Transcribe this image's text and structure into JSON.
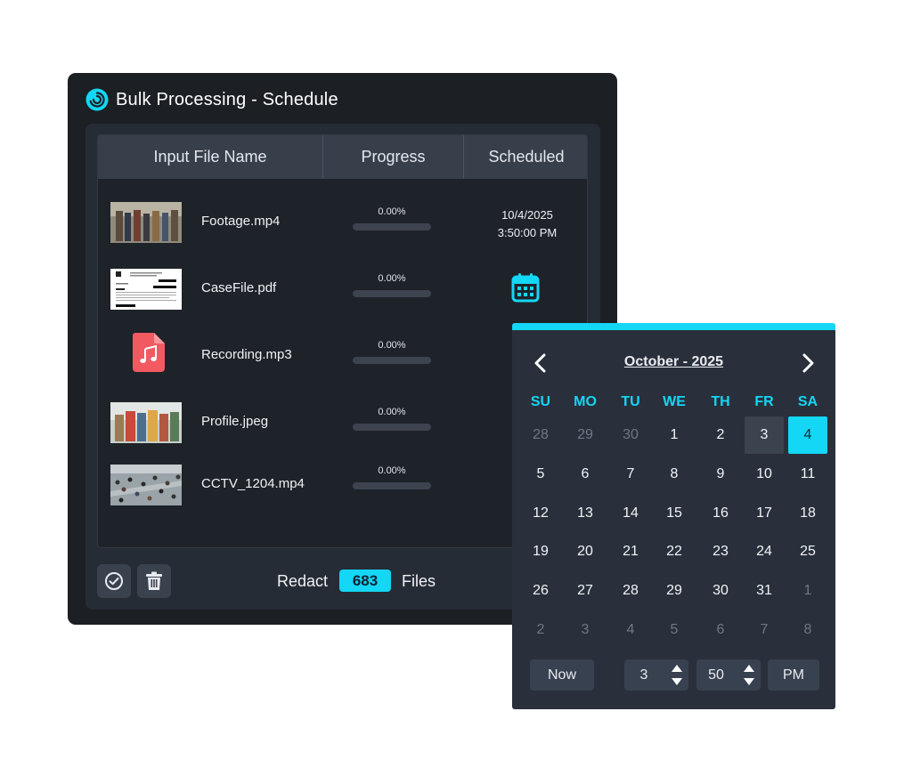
{
  "window": {
    "title": "Bulk Processing - Schedule",
    "logo_icon": "swirl-logo-icon",
    "accent": "#14d6f5"
  },
  "table": {
    "headers": [
      "Input File Name",
      "Progress",
      "Scheduled"
    ],
    "rows": [
      {
        "name": "Footage.mp4",
        "progress": 0,
        "progress_label": "0.00%",
        "scheduled_date": "10/4/2025",
        "scheduled_time": "3:50:00 PM",
        "thumb": "crowd-street"
      },
      {
        "name": "CaseFile.pdf",
        "progress": 0,
        "progress_label": "0.00%",
        "scheduled_icon": "calendar-icon",
        "thumb": "document"
      },
      {
        "name": "Recording.mp3",
        "progress": 0,
        "progress_label": "0.00%",
        "thumb": "audio-file-icon"
      },
      {
        "name": "Profile.jpeg",
        "progress": 0,
        "progress_label": "0.00%",
        "thumb": "people-blurred"
      },
      {
        "name": "CCTV_1204.mp4",
        "progress": 0,
        "progress_label": "0.00%",
        "thumb": "crowd-aerial"
      }
    ]
  },
  "footer": {
    "approve_icon": "check-circle-icon",
    "delete_icon": "trash-icon",
    "redact_label": "Redact",
    "count": "683",
    "files_label": "Files"
  },
  "picker": {
    "month_label": "October - 2025",
    "prev_icon": "chevron-left-icon",
    "next_icon": "chevron-right-icon",
    "weekdays": [
      "SU",
      "MO",
      "TU",
      "WE",
      "TH",
      "FR",
      "SA"
    ],
    "days": [
      {
        "d": "28",
        "m": true
      },
      {
        "d": "29",
        "m": true
      },
      {
        "d": "30",
        "m": true
      },
      {
        "d": "1"
      },
      {
        "d": "2"
      },
      {
        "d": "3",
        "hover": true
      },
      {
        "d": "4",
        "sel": true
      },
      {
        "d": "5"
      },
      {
        "d": "6"
      },
      {
        "d": "7"
      },
      {
        "d": "8"
      },
      {
        "d": "9"
      },
      {
        "d": "10"
      },
      {
        "d": "11"
      },
      {
        "d": "12"
      },
      {
        "d": "13"
      },
      {
        "d": "14"
      },
      {
        "d": "15"
      },
      {
        "d": "16"
      },
      {
        "d": "17"
      },
      {
        "d": "18"
      },
      {
        "d": "19"
      },
      {
        "d": "20"
      },
      {
        "d": "21"
      },
      {
        "d": "22"
      },
      {
        "d": "23"
      },
      {
        "d": "24"
      },
      {
        "d": "25"
      },
      {
        "d": "26"
      },
      {
        "d": "27"
      },
      {
        "d": "28"
      },
      {
        "d": "29"
      },
      {
        "d": "30"
      },
      {
        "d": "31"
      },
      {
        "d": "1",
        "m": true
      },
      {
        "d": "2",
        "m": true
      },
      {
        "d": "3",
        "m": true
      },
      {
        "d": "4",
        "m": true
      },
      {
        "d": "5",
        "m": true
      },
      {
        "d": "6",
        "m": true
      },
      {
        "d": "7",
        "m": true
      },
      {
        "d": "8",
        "m": true
      }
    ],
    "now_label": "Now",
    "hour": "3",
    "minute": "50",
    "ampm": "PM"
  }
}
